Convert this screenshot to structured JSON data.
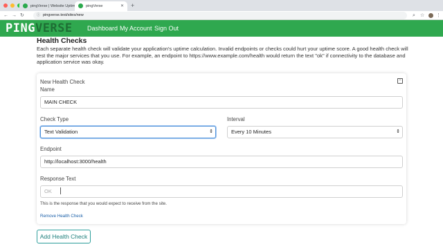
{
  "browser": {
    "tabs": [
      {
        "title": "pingVerse | Website Uptime M..."
      },
      {
        "title": "pingVerse"
      }
    ],
    "new_tab": "+",
    "url": "pingverse.test/sites/new"
  },
  "header": {
    "brand_part1": "PING",
    "brand_part2": "VERSE",
    "links": [
      "Dashboard",
      "My Account",
      "Sign Out"
    ]
  },
  "page": {
    "heading": "Health Checks",
    "description": "Each separate health check will validate your application's uptime calculation. Invalid endpoints or checks could hurt your uptime score. A good health check will test the major services that you use. For example, an endpoint to https://www.example.com/health would return the text \"ok\" if connectivity to the database and application service was okay."
  },
  "form": {
    "card_title": "New Health Check",
    "collapse_symbol": "−",
    "name_label": "Name",
    "name_value": "MAIN CHECK",
    "check_type_label": "Check Type",
    "check_type_value": "Text Validation",
    "interval_label": "Interval",
    "interval_value": "Every 10 Minutes",
    "endpoint_label": "Endpoint",
    "endpoint_value": "http://localhost:3000/health",
    "response_label": "Response Text",
    "response_placeholder": "OK",
    "response_help": "This is the response that you would expect to receive from the site.",
    "remove_label": "Remove Health Check"
  },
  "actions": {
    "add_label": "Add Health Check"
  },
  "colors": {
    "nav_green": "#2fa84f",
    "link_blue": "#1a5fa8",
    "button_teal": "#2b9d9a"
  }
}
